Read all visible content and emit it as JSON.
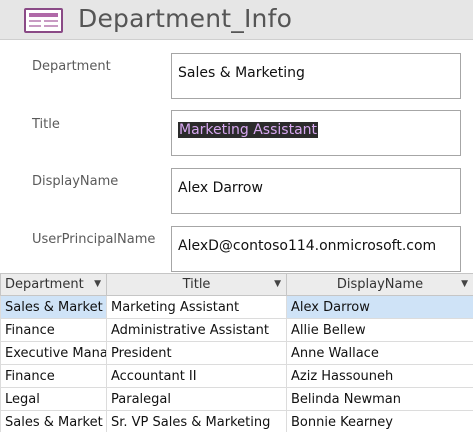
{
  "header": {
    "title": "Department_Info",
    "icon": "form-icon"
  },
  "form": {
    "department_label": "Department",
    "department_value": "Sales & Marketing",
    "title_label": "Title",
    "title_value": "Marketing Assistant",
    "displayname_label": "DisplayName",
    "displayname_value": "Alex Darrow",
    "upn_label": "UserPrincipalName",
    "upn_value": "AlexD@contoso114.onmicrosoft.com"
  },
  "datasheet": {
    "columns": [
      "Department",
      "Title",
      "DisplayName"
    ],
    "rows": [
      [
        "Sales & Market",
        "Marketing Assistant",
        "Alex Darrow"
      ],
      [
        "Finance",
        "Administrative Assistant",
        "Allie Bellew"
      ],
      [
        "Executive Mana",
        "President",
        "Anne Wallace"
      ],
      [
        "Finance",
        "Accountant II",
        "Aziz Hassouneh"
      ],
      [
        "Legal",
        "Paralegal",
        "Belinda Newman"
      ],
      [
        "Sales & Market",
        "Sr. VP Sales & Marketing",
        "Bonnie Kearney"
      ]
    ]
  },
  "colors": {
    "header_bg": "#e6e6e6",
    "selection_bg": "#cfe3f7",
    "icon_accent": "#8a4a86"
  }
}
